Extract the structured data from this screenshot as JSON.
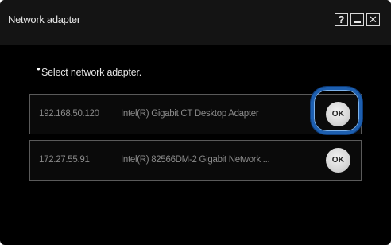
{
  "window": {
    "title": "Network adapter",
    "help_label": "?",
    "close_label": "✕"
  },
  "instruction": "Select network adapter.",
  "adapters": [
    {
      "ip": "192.168.50.120",
      "name": "Intel(R) Gigabit CT Desktop Adapter",
      "ok_label": "OK",
      "highlighted": true
    },
    {
      "ip": "172.27.55.91",
      "name": "Intel(R) 82566DM-2 Gigabit Network ...",
      "ok_label": "OK",
      "highlighted": false
    }
  ],
  "colors": {
    "background": "#000000",
    "highlight": "#1d5fb0",
    "text_dim": "#8a8a8a"
  }
}
